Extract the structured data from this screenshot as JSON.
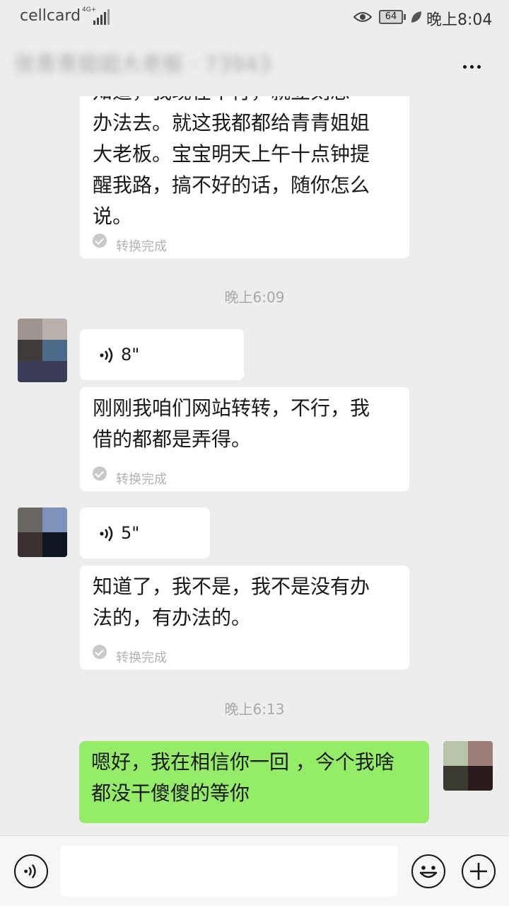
{
  "status_bar": {
    "carrier": "cellcard",
    "network": "4G+",
    "battery": "64",
    "time": "晚上8:04"
  },
  "nav": {
    "title": "张青青姐姐大老板 · 73943",
    "more_icon": "more-dots-icon"
  },
  "messages": [
    {
      "type": "voice_text",
      "lines": [
        "知道，我现在不行，就立刻想",
        "办法去。就这我都都给青青姐姐",
        "大老板。宝宝明天上午十点钟提",
        "醒我路，搞不好的话，随你怎么",
        "说。"
      ],
      "status": "转换完成"
    },
    {
      "type": "time",
      "text": "晚上6:09"
    },
    {
      "type": "voice",
      "duration": "8\""
    },
    {
      "type": "voice_text",
      "lines": [
        "刚刚我咱们网站转转，不行，我",
        "借的都都是弄得。"
      ],
      "status": "转换完成"
    },
    {
      "type": "voice",
      "duration": "5\""
    },
    {
      "type": "voice_text",
      "lines": [
        "知道了，我不是，我不是没有办",
        "法的，有办法的。"
      ],
      "status": "转换完成"
    },
    {
      "type": "time",
      "text": "晚上6:13"
    },
    {
      "type": "sent_text",
      "lines": [
        "嗯好，我在相信你一回 ，今个我啥",
        "都没干傻傻的等你"
      ]
    }
  ],
  "input_bar": {
    "voice_icon": "voice-mode-icon",
    "emoji_icon": "emoji-icon",
    "plus_icon": "plus-icon",
    "value": ""
  },
  "colors": {
    "background": "#ededed",
    "received_bubble": "#ffffff",
    "sent_bubble": "#95ec69",
    "timestamp": "#a8a8a8"
  }
}
